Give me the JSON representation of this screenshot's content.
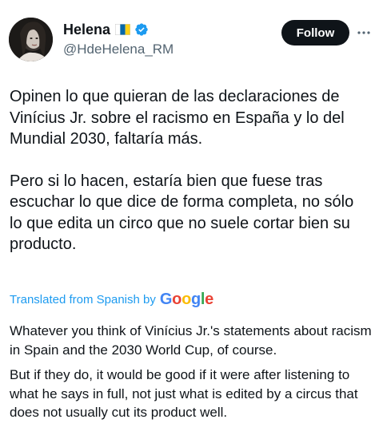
{
  "author": {
    "display_name": "Helena",
    "handle": "@HdeHelena_RM",
    "flag_icon": "canary-islands-flag-icon",
    "verified_icon": "verified-badge-icon",
    "verified_color": "#1d9bf0"
  },
  "actions": {
    "follow_label": "Follow",
    "more_icon": "more-options-icon"
  },
  "tweet": {
    "paragraphs": [
      "Opinen lo que quieran de las declaraciones de Vinícius Jr. sobre el racismo en España y lo del Mundial 2030, faltaría más.",
      "Pero si lo hacen, estaría bien que fuese tras escuchar lo que dice de forma completa, no sólo lo que edita un circo que no suele cortar bien su producto."
    ]
  },
  "translation": {
    "label": "Translated from Spanish by",
    "provider": "Google",
    "link_color": "#1d9bf0",
    "paragraphs": [
      "Whatever you think of Vinícius Jr.'s statements about racism in Spain and the 2030 World Cup, of course.",
      "But if they do, it would be good if it were after listening to what he says in full, not just what is edited by a circus that does not usually cut its product well."
    ]
  }
}
